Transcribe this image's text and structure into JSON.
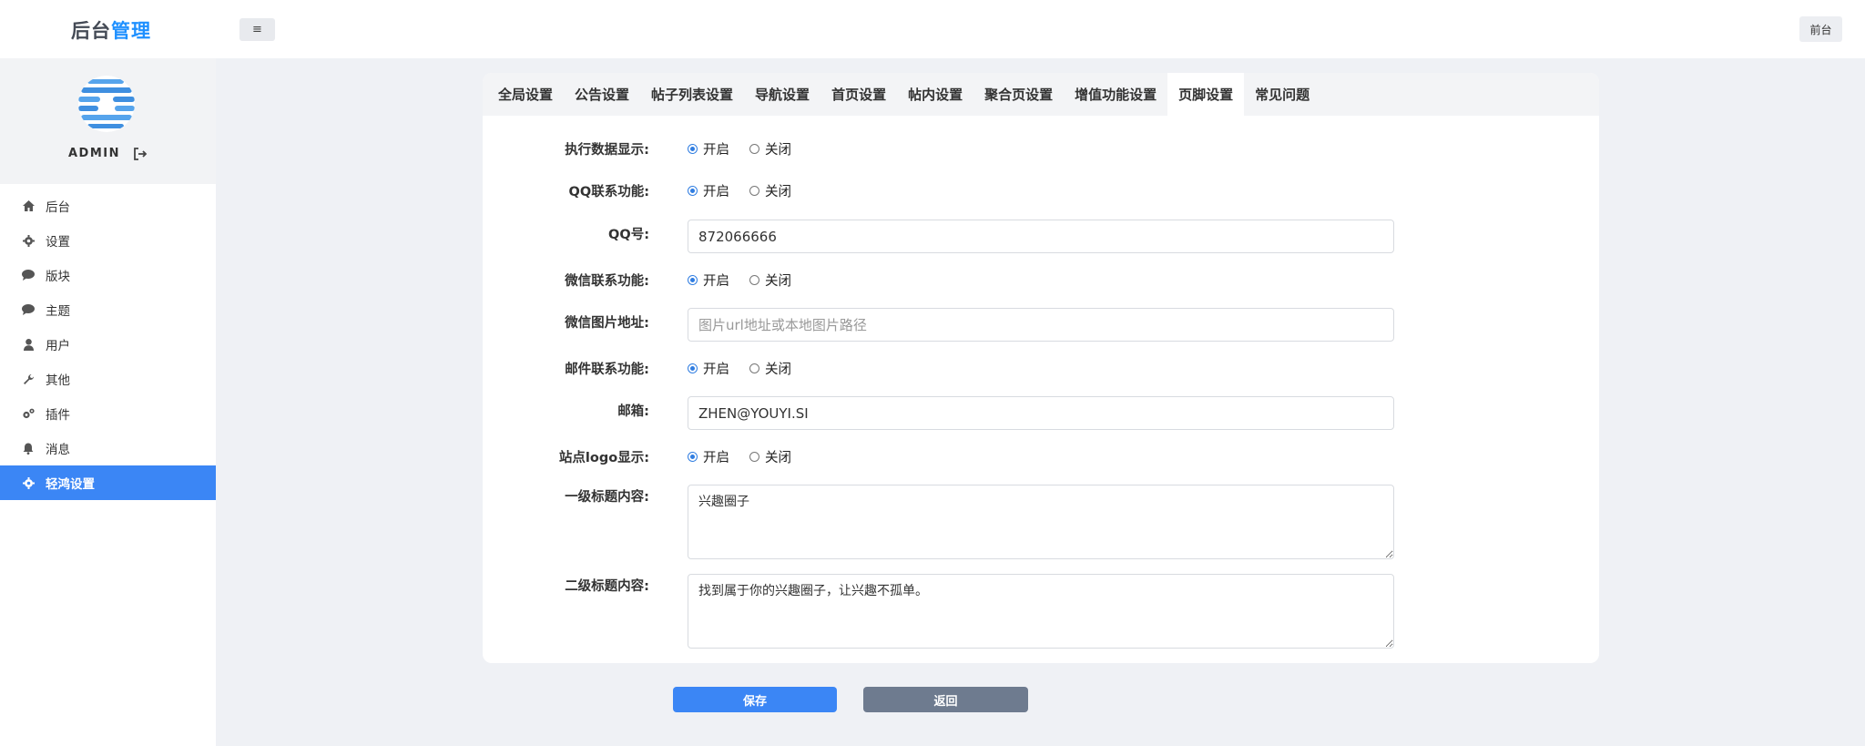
{
  "header": {
    "logo_part1": "后台",
    "logo_part2": "管理",
    "menu_toggle": "≡",
    "front_button": "前台"
  },
  "sidebar": {
    "username": "ADMIN",
    "items": [
      {
        "label": "后台",
        "icon": "home-icon"
      },
      {
        "label": "设置",
        "icon": "gear-icon"
      },
      {
        "label": "版块",
        "icon": "comment-icon"
      },
      {
        "label": "主题",
        "icon": "comment-icon"
      },
      {
        "label": "用户",
        "icon": "user-icon"
      },
      {
        "label": "其他",
        "icon": "wrench-icon"
      },
      {
        "label": "插件",
        "icon": "gears-icon"
      },
      {
        "label": "消息",
        "icon": "bell-icon"
      },
      {
        "label": "轻鸿设置",
        "icon": "gear-icon",
        "active": true
      }
    ]
  },
  "tabs": [
    "全局设置",
    "公告设置",
    "帖子列表设置",
    "导航设置",
    "首页设置",
    "帖内设置",
    "聚合页设置",
    "增值功能设置",
    "页脚设置",
    "常见问题"
  ],
  "active_tab": "页脚设置",
  "form": {
    "exec_data": {
      "label": "执行数据显示:",
      "on": "开启",
      "off": "关闭",
      "selected": "开启"
    },
    "qq_contact": {
      "label": "QQ联系功能:",
      "on": "开启",
      "off": "关闭",
      "selected": "开启"
    },
    "qq_number": {
      "label": "QQ号:",
      "value": "872066666"
    },
    "wechat_contact": {
      "label": "微信联系功能:",
      "on": "开启",
      "off": "关闭",
      "selected": "开启"
    },
    "wechat_image": {
      "label": "微信图片地址:",
      "value": "",
      "placeholder": "图片url地址或本地图片路径"
    },
    "mail_contact": {
      "label": "邮件联系功能:",
      "on": "开启",
      "off": "关闭",
      "selected": "开启"
    },
    "email": {
      "label": "邮箱:",
      "value": "ZHEN@YOUYI.SI"
    },
    "site_logo": {
      "label": "站点logo显示:",
      "on": "开启",
      "off": "关闭",
      "selected": "开启"
    },
    "title1": {
      "label": "一级标题内容:",
      "value": "兴趣圈子"
    },
    "title2": {
      "label": "二级标题内容:",
      "value": "找到属于你的兴趣圈子，让兴趣不孤单。"
    }
  },
  "buttons": {
    "save": "保存",
    "back": "返回"
  },
  "colors": {
    "accent": "#3b86f5",
    "back_button": "#6e7b8f",
    "background": "#eff1f5"
  }
}
